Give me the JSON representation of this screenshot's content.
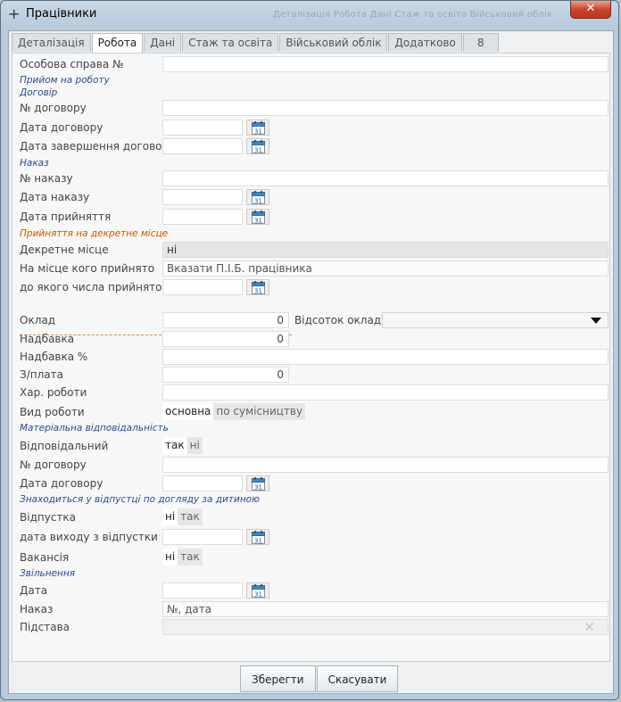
{
  "window": {
    "title": "Працівники",
    "ghost_text": "Деталізація    Робота    Дані    Стаж та освіта    Військовий облік",
    "close_label": "✕"
  },
  "tabs": [
    "Деталізація",
    "Робота",
    "Дані",
    "Стаж та освіта",
    "Військовий облік",
    "Додатково",
    "8"
  ],
  "active_tab": 1,
  "sections": {
    "hire": "Прийом на роботу",
    "contract": "Договір",
    "order": "Наказ",
    "maternity": "Прийняття на декретне місце",
    "liability": "Матеріальна відповідальність",
    "leave": "Знаходиться у відпустці по догляду за дитиною",
    "dismissal": "Звільнення"
  },
  "fields": {
    "personal_file": {
      "label": "Особова справа №",
      "value": ""
    },
    "contract_no": {
      "label": "№ договору",
      "value": ""
    },
    "contract_date": {
      "label": "Дата договору",
      "value": ""
    },
    "contract_end": {
      "label": "Дата завершення договору",
      "value": ""
    },
    "order_no": {
      "label": "№ наказу",
      "value": ""
    },
    "order_date": {
      "label": "Дата наказу",
      "value": ""
    },
    "hire_date": {
      "label": "Дата прийняття",
      "value": ""
    },
    "maternity_place": {
      "label": "Декретне місце",
      "value": "ні"
    },
    "replacing_whom": {
      "label": "На місце кого прийнято",
      "placeholder": "Вказати П.І.Б. працівника"
    },
    "hired_until": {
      "label": "до якого числа прийнято",
      "value": ""
    },
    "salary": {
      "label": "Оклад",
      "value": "0"
    },
    "salary_percent": {
      "label": "Відсоток окладу",
      "value": ""
    },
    "bonus": {
      "label": "Надбавка",
      "value": "0"
    },
    "bonus_percent": {
      "label": "Надбавка %",
      "value": ""
    },
    "pay": {
      "label": "З/плата",
      "value": "0"
    },
    "work_character": {
      "label": "Хар. роботи",
      "value": ""
    },
    "work_type": {
      "label": "Вид роботи",
      "options": [
        "основна",
        "по сумісництву"
      ],
      "selected": 0
    },
    "responsible": {
      "label": "Відповідальний",
      "options": [
        "так",
        "ні"
      ],
      "selected": 0
    },
    "liability_contract_no": {
      "label": "№ договору",
      "value": ""
    },
    "liability_contract_date": {
      "label": "Дата договору",
      "value": ""
    },
    "leave": {
      "label": "Відпустка",
      "options": [
        "ні",
        "так"
      ],
      "selected": 0
    },
    "leave_return_date": {
      "label": "дата виходу з відпустки",
      "value": ""
    },
    "vacancy": {
      "label": "Вакансія",
      "options": [
        "ні",
        "так"
      ],
      "selected": 0
    },
    "dismissal_date": {
      "label": "Дата",
      "value": ""
    },
    "dismissal_order": {
      "label": "Наказ",
      "placeholder": "№, дата"
    },
    "dismissal_basis": {
      "label": "Підстава",
      "value": ""
    }
  },
  "calendar_day": "31",
  "buttons": {
    "save": "Зберегти",
    "cancel": "Скасувати"
  },
  "colors": {
    "section": "#2a4a8a",
    "section_orange": "#c05a00",
    "close": "#c8442d"
  }
}
